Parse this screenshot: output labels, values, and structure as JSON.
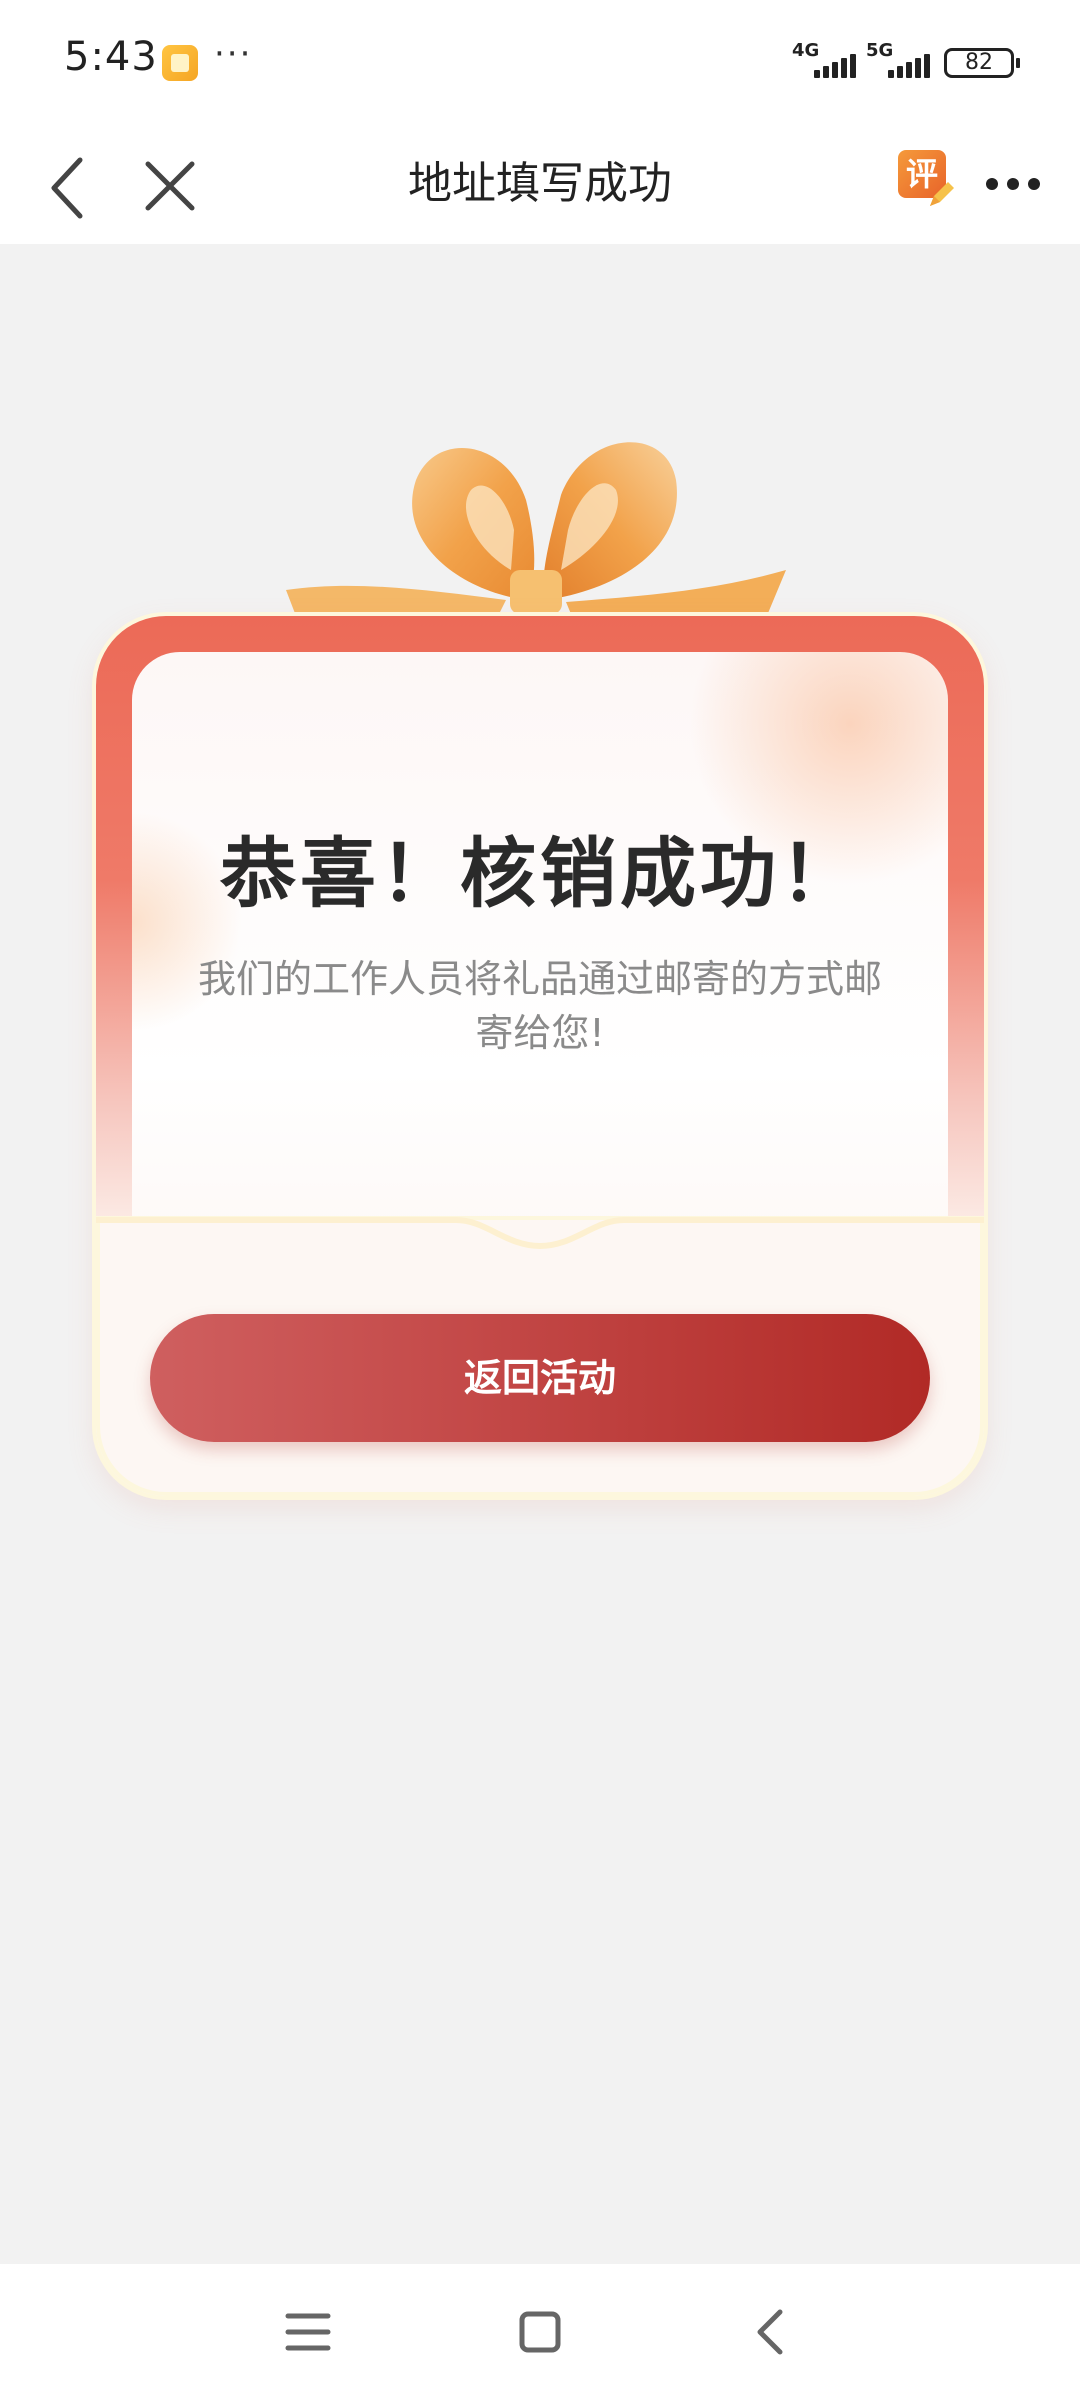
{
  "status_bar": {
    "time": "5:43",
    "more_dots": "···",
    "signal_1_label": "4G",
    "signal_2_label": "5G",
    "battery_level": "82"
  },
  "nav": {
    "title": "地址填写成功",
    "review_badge": "评"
  },
  "card": {
    "title": "恭喜！核销成功！",
    "message": "我们的工作人员将礼品通过邮寄的方式邮寄给您!",
    "button_label": "返回活动"
  },
  "colors": {
    "accent_red": "#b12a26",
    "frame_red": "#ec6a57",
    "bow_orange": "#f2a24a",
    "page_bg": "#f2f2f2"
  },
  "icons": {
    "back": "chevron-left-icon",
    "close": "close-icon",
    "more": "more-horizontal-icon",
    "review": "review-edit-icon",
    "sys_menu": "menu-icon",
    "sys_home": "home-square-icon",
    "sys_back": "back-arrow-icon"
  }
}
